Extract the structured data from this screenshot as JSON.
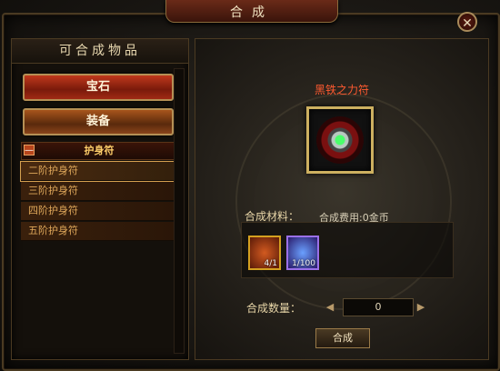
{
  "window": {
    "title": "合成"
  },
  "left": {
    "header": "可合成物品",
    "categories": [
      "宝石",
      "装备"
    ],
    "group": {
      "toggle": "—",
      "label": "护身符"
    },
    "items": [
      "二阶护身符",
      "三阶护身符",
      "四阶护身符",
      "五阶护身符"
    ],
    "selected_index": 0
  },
  "right": {
    "target_name": "黑铁之力符",
    "material_label": "合成材料：",
    "cost_text": "合成费用:0金币",
    "materials": [
      {
        "icon": "amulet-icon",
        "count": "4/1"
      },
      {
        "icon": "crystal-icon",
        "count": "1/100"
      }
    ],
    "quantity_label": "合成数量：",
    "quantity_value": "0",
    "compose_button": "合成"
  },
  "colors": {
    "accent": "#ff5a30",
    "gold": "#cdb060"
  }
}
